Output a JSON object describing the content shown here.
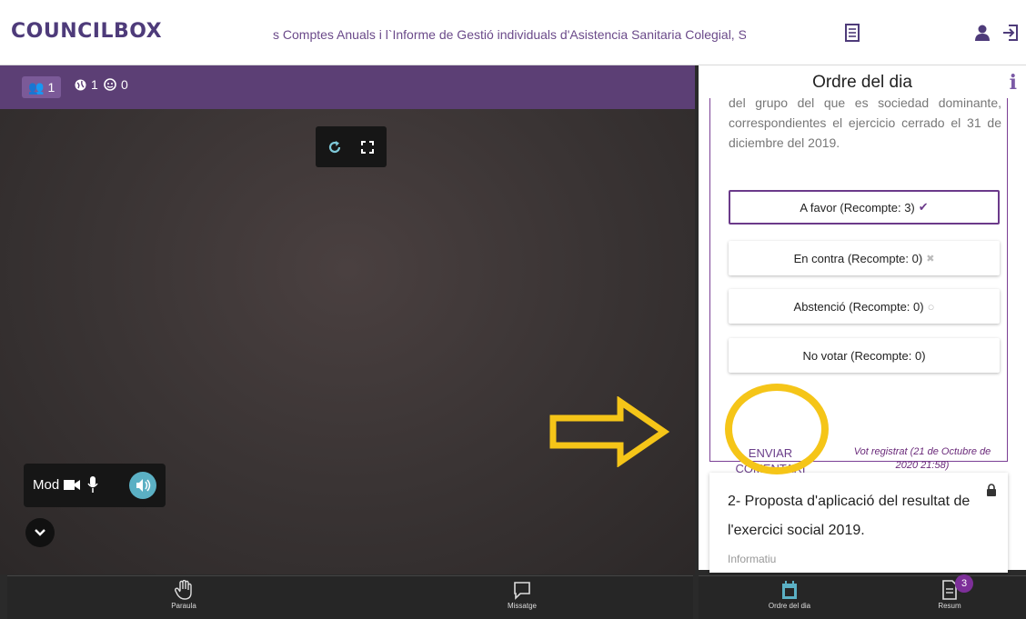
{
  "header": {
    "logo": "COUNCILBOX",
    "meeting_title": "s Comptes Anuals i l`Informe de Gestió individuals d'Asistencia Sanitaria Colegial, S. A. de Segur",
    "icons": [
      "document-list-icon",
      "user-icon",
      "logout-icon"
    ]
  },
  "video": {
    "counts": {
      "participants": "1",
      "online": "1",
      "guests": "0"
    },
    "mod_label": "Mod"
  },
  "agenda": {
    "title": "Ordre del dia",
    "text": "del grupo del que es sociedad dominante, correspondientes el ejercicio cerrado el 31 de diciembre del 2019.",
    "options": [
      {
        "label": "A favor (Recompte: 3)",
        "mark": "✔",
        "selected": true
      },
      {
        "label": "En contra (Recompte: 0)",
        "mark": "✖",
        "selected": false
      },
      {
        "label": "Abstenció (Recompte: 0)",
        "mark": "○",
        "selected": false
      },
      {
        "label": "No votar (Recompte: 0)",
        "mark": "",
        "selected": false
      }
    ],
    "send_comment": "ENVIAR COMENTARI",
    "vote_status": "Vot registrat (21 de Octubre de 2020 21:58)",
    "next_item": {
      "title": "2- Proposta d'aplicació del resultat de l'exercici social 2019.",
      "type": "Informatiu"
    }
  },
  "bottom_nav": {
    "items": [
      {
        "label": "Paraula",
        "icon": "raise-hand-icon"
      },
      {
        "label": "Missatge",
        "icon": "message-icon"
      },
      {
        "label": "Ordre del dia",
        "icon": "calendar-icon"
      },
      {
        "label": "Resum",
        "icon": "summary-document-icon",
        "badge": "3"
      }
    ]
  },
  "colors": {
    "brand": "#4e3b7a",
    "accent": "#7b3f95",
    "highlight": "#f5c518"
  }
}
